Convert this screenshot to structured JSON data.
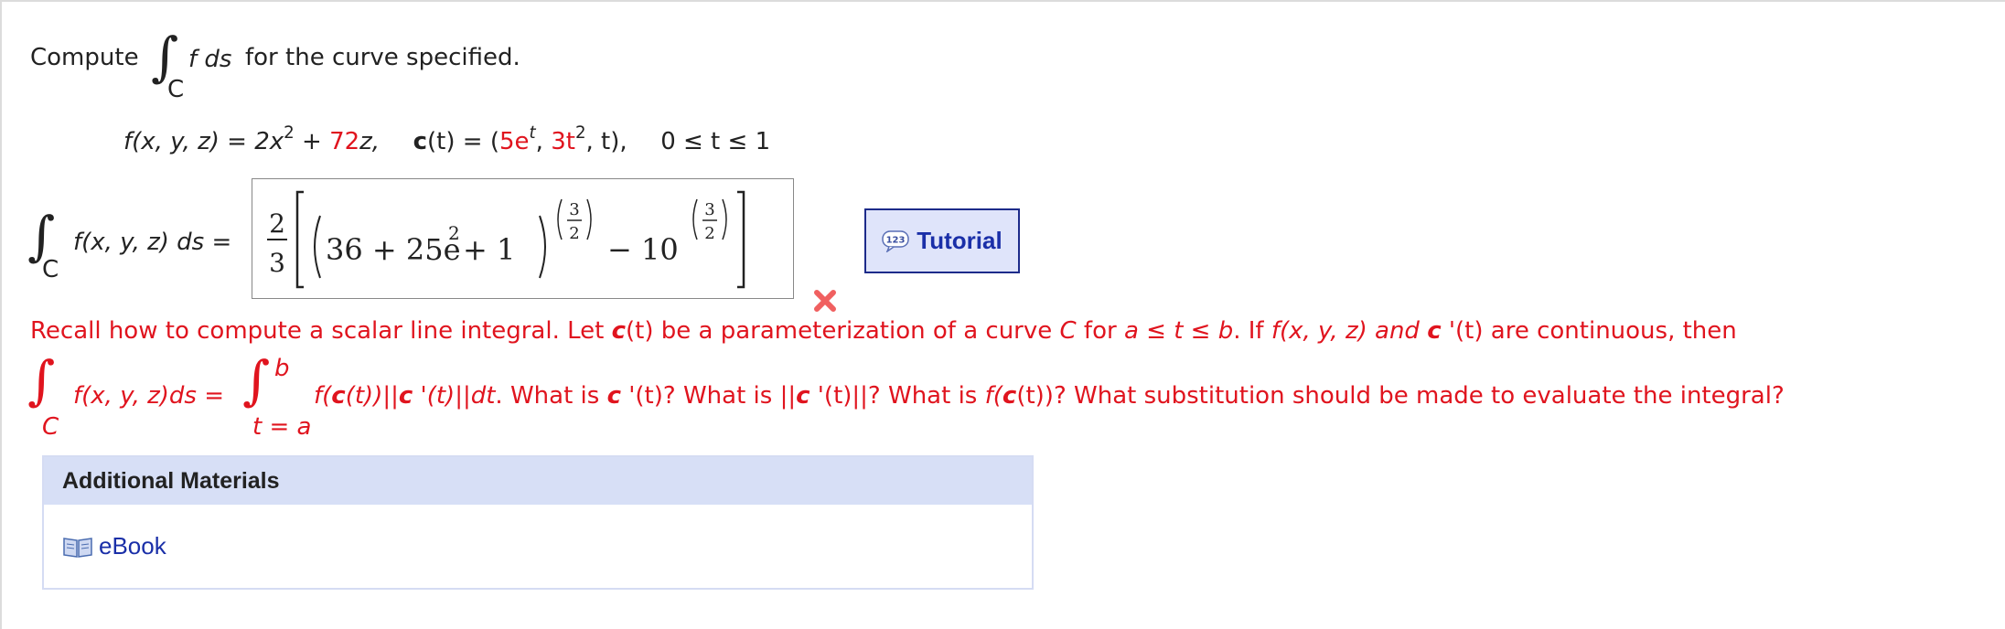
{
  "question": {
    "prefix": "Compute",
    "integral_sub": "C",
    "integrand": "f ds",
    "suffix": "for the curve specified."
  },
  "given": {
    "f_lhs": "f(x, y, z) = 2x",
    "f_exp": "2",
    "f_plus": " + ",
    "f_coef": "72",
    "f_var": "z,",
    "c_bold": "c",
    "c_lhs": "(t) = (",
    "c_comp1": "5e",
    "c_exp1": "t",
    "c_sep1": ", ",
    "c_comp2": "3t",
    "c_exp2": "2",
    "c_rest": ", t),",
    "range": "0 ≤ t ≤ 1"
  },
  "answer": {
    "integral_sub": "C",
    "lhs": "f(x, y, z) ds =",
    "frac_num": "2",
    "frac_den": "3",
    "inner_a": "36 + 25e",
    "inner_exp": "2",
    "inner_b": " + 1",
    "exp_num": "3",
    "exp_den": "2",
    "minus": "− 10",
    "status": "incorrect"
  },
  "tutorial": {
    "label": "Tutorial",
    "icon": "123-speech-icon"
  },
  "feedback": {
    "line1": {
      "a": "Recall how to compute a scalar line integral. Let ",
      "c1": "c",
      "b": "(t) be a parameterization of a curve ",
      "C": "C",
      "d": " for ",
      "range": "a ≤ t ≤ b",
      "e": ". If ",
      "f": "f(x, y, z)",
      "and": " and ",
      "c2": "c",
      "g": " '(t) are continuous, then"
    },
    "line2": {
      "sub_C": "C",
      "lhs": "f(x, y, z)ds = ",
      "upper": "b",
      "lower": "t = a",
      "integrand_a": "f(",
      "c1": "c",
      "integrand_b": "(t))||",
      "c2": "c",
      "integrand_c": " '(t)||dt",
      "q1a": ". What is ",
      "c3": "c",
      "q1b": " '(t)? What is ||",
      "c4": "c",
      "q2b": " '(t)||? What is ",
      "q3f": "f(",
      "c5": "c",
      "q3b": "(t))? What substitution should be made to evaluate the integral?"
    }
  },
  "additional": {
    "title": "Additional Materials",
    "ebook": "eBook"
  },
  "colors": {
    "red": "#e0141e",
    "link": "#1a2fa8",
    "panel": "#d7dff6"
  }
}
